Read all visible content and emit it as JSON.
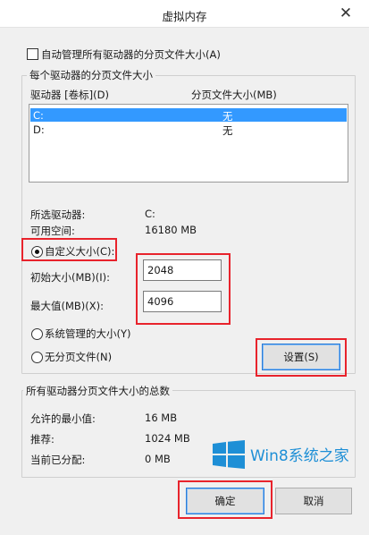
{
  "window": {
    "title": "虚拟内存",
    "close_glyph": "✕"
  },
  "auto_manage": {
    "label": "自动管理所有驱动器的分页文件大小(A)",
    "checked": false
  },
  "per_drive": {
    "group_title": "每个驱动器的分页文件大小",
    "col_drive": "驱动器 [卷标](D)",
    "col_size": "分页文件大小(MB)",
    "rows": [
      {
        "drive": "C:",
        "size": "无",
        "selected": true
      },
      {
        "drive": "D:",
        "size": "无",
        "selected": false
      }
    ],
    "selected_drive_label": "所选驱动器:",
    "selected_drive_value": "C:",
    "free_space_label": "可用空间:",
    "free_space_value": "16180 MB",
    "custom_size": {
      "label": "自定义大小(C):",
      "selected": true
    },
    "initial_size": {
      "label": "初始大小(MB)(I):",
      "value": "2048"
    },
    "max_size": {
      "label": "最大值(MB)(X):",
      "value": "4096"
    },
    "system_managed": {
      "label": "系统管理的大小(Y)",
      "selected": false
    },
    "no_paging": {
      "label": "无分页文件(N)",
      "selected": false
    },
    "set_button": "设置(S)"
  },
  "totals": {
    "group_title": "所有驱动器分页文件大小的总数",
    "min_label": "允许的最小值:",
    "min_value": "16 MB",
    "recommended_label": "推荐:",
    "recommended_value": "1024 MB",
    "current_label": "当前已分配:",
    "current_value": "0 MB"
  },
  "watermark": {
    "text": "Win8系统之家"
  },
  "buttons": {
    "ok": "确定",
    "cancel": "取消"
  },
  "colors": {
    "selection": "#3399ff",
    "highlight_box": "#e8232c",
    "watermark": "#1e8fd6"
  }
}
